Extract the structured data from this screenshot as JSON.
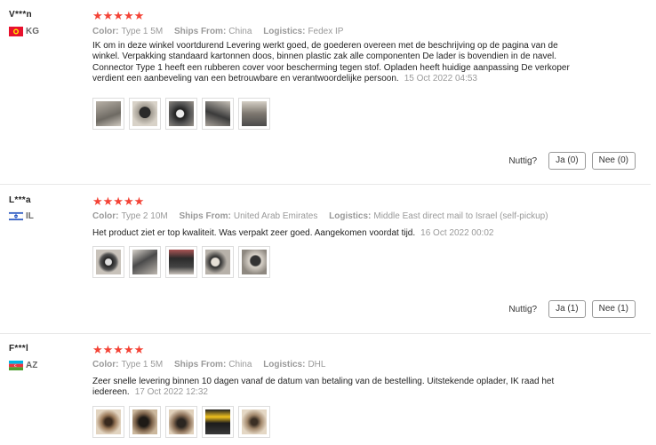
{
  "helpful_label": "Nuttig?",
  "reviews": [
    {
      "user": "V***n",
      "country": "KG",
      "stars": "★★★★★",
      "color_label": "Color:",
      "color": "Type 1 5M",
      "ships_label": "Ships From:",
      "ships": "China",
      "logistics_label": "Logistics:",
      "logistics": "Fedex IP",
      "text": "IK om in deze winkel voortdurend Levering werkt goed, de goederen overeen met de beschrijving op de pagina van de winkel. Verpakking standaard kartonnen doos, binnen plastic zak alle componenten De lader is bovendien in de navel. Connector Type 1 heeft een rubberen cover voor bescherming tegen stof. Opladen heeft huidige aanpassing De verkoper verdient een aanbeveling van een betrouwbare en verantwoordelijke persoon.",
      "date": "15 Oct 2022 04:53",
      "yes": "Ja (0)",
      "no": "Nee (0)"
    },
    {
      "user": "L***a",
      "country": "IL",
      "stars": "★★★★★",
      "color_label": "Color:",
      "color": "Type 2 10M",
      "ships_label": "Ships From:",
      "ships": "United Arab Emirates",
      "logistics_label": "Logistics:",
      "logistics": "Middle East direct mail to Israel (self-pickup)",
      "text": "Het product ziet er top kwaliteit. Was verpakt zeer goed. Aangekomen voordat tijd.",
      "date": "16 Oct 2022 00:02",
      "yes": "Ja (1)",
      "no": "Nee (1)"
    },
    {
      "user": "F***l",
      "country": "AZ",
      "stars": "★★★★★",
      "color_label": "Color:",
      "color": "Type 1 5M",
      "ships_label": "Ships From:",
      "ships": "China",
      "logistics_label": "Logistics:",
      "logistics": "DHL",
      "text": "Zeer snelle levering binnen 10 dagen vanaf de datum van betaling van de bestelling. Uitstekende oplader, IK raad het iedereen.",
      "date": "17 Oct 2022 12:32"
    }
  ]
}
